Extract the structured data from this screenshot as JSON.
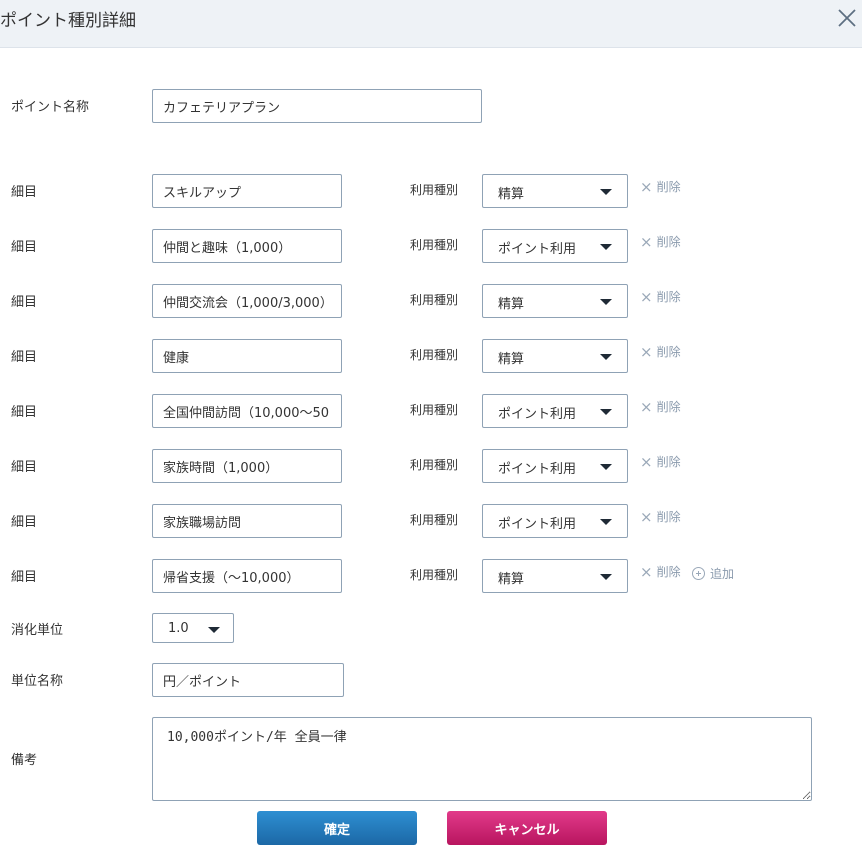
{
  "header": {
    "title": "ポイント種別詳細",
    "close_icon": "close-icon"
  },
  "point_name": {
    "label": "ポイント名称",
    "value": "カフェテリアプラン"
  },
  "items": [
    {
      "label": "細目",
      "value": "スキルアップ",
      "type_label": "利用種別",
      "type_value": "精算",
      "delete_label": "削除"
    },
    {
      "label": "細目",
      "value": "仲間と趣味（1,000）",
      "type_label": "利用種別",
      "type_value": "ポイント利用",
      "delete_label": "削除"
    },
    {
      "label": "細目",
      "value": "仲間交流会（1,000/3,000）",
      "type_label": "利用種別",
      "type_value": "精算",
      "delete_label": "削除"
    },
    {
      "label": "細目",
      "value": "健康",
      "type_label": "利用種別",
      "type_value": "精算",
      "delete_label": "削除"
    },
    {
      "label": "細目",
      "value": "全国仲間訪問（10,000～50",
      "type_label": "利用種別",
      "type_value": "ポイント利用",
      "delete_label": "削除"
    },
    {
      "label": "細目",
      "value": "家族時間（1,000）",
      "type_label": "利用種別",
      "type_value": "ポイント利用",
      "delete_label": "削除"
    },
    {
      "label": "細目",
      "value": "家族職場訪問",
      "type_label": "利用種別",
      "type_value": "ポイント利用",
      "delete_label": "削除"
    },
    {
      "label": "細目",
      "value": "帰省支援（～10,000）",
      "type_label": "利用種別",
      "type_value": "精算",
      "delete_label": "削除"
    }
  ],
  "add_label": "追加",
  "consumption_unit": {
    "label": "消化単位",
    "value": "1.0"
  },
  "unit_name": {
    "label": "単位名称",
    "value": "円／ポイント"
  },
  "remarks": {
    "label": "備考",
    "value": "10,000ポイント/年 全員一律"
  },
  "buttons": {
    "confirm": "確定",
    "cancel": "キャンセル"
  },
  "colors": {
    "header_bg": "#eef2f6",
    "confirm_bg": "#1f77bb",
    "cancel_bg": "#cc2272"
  }
}
